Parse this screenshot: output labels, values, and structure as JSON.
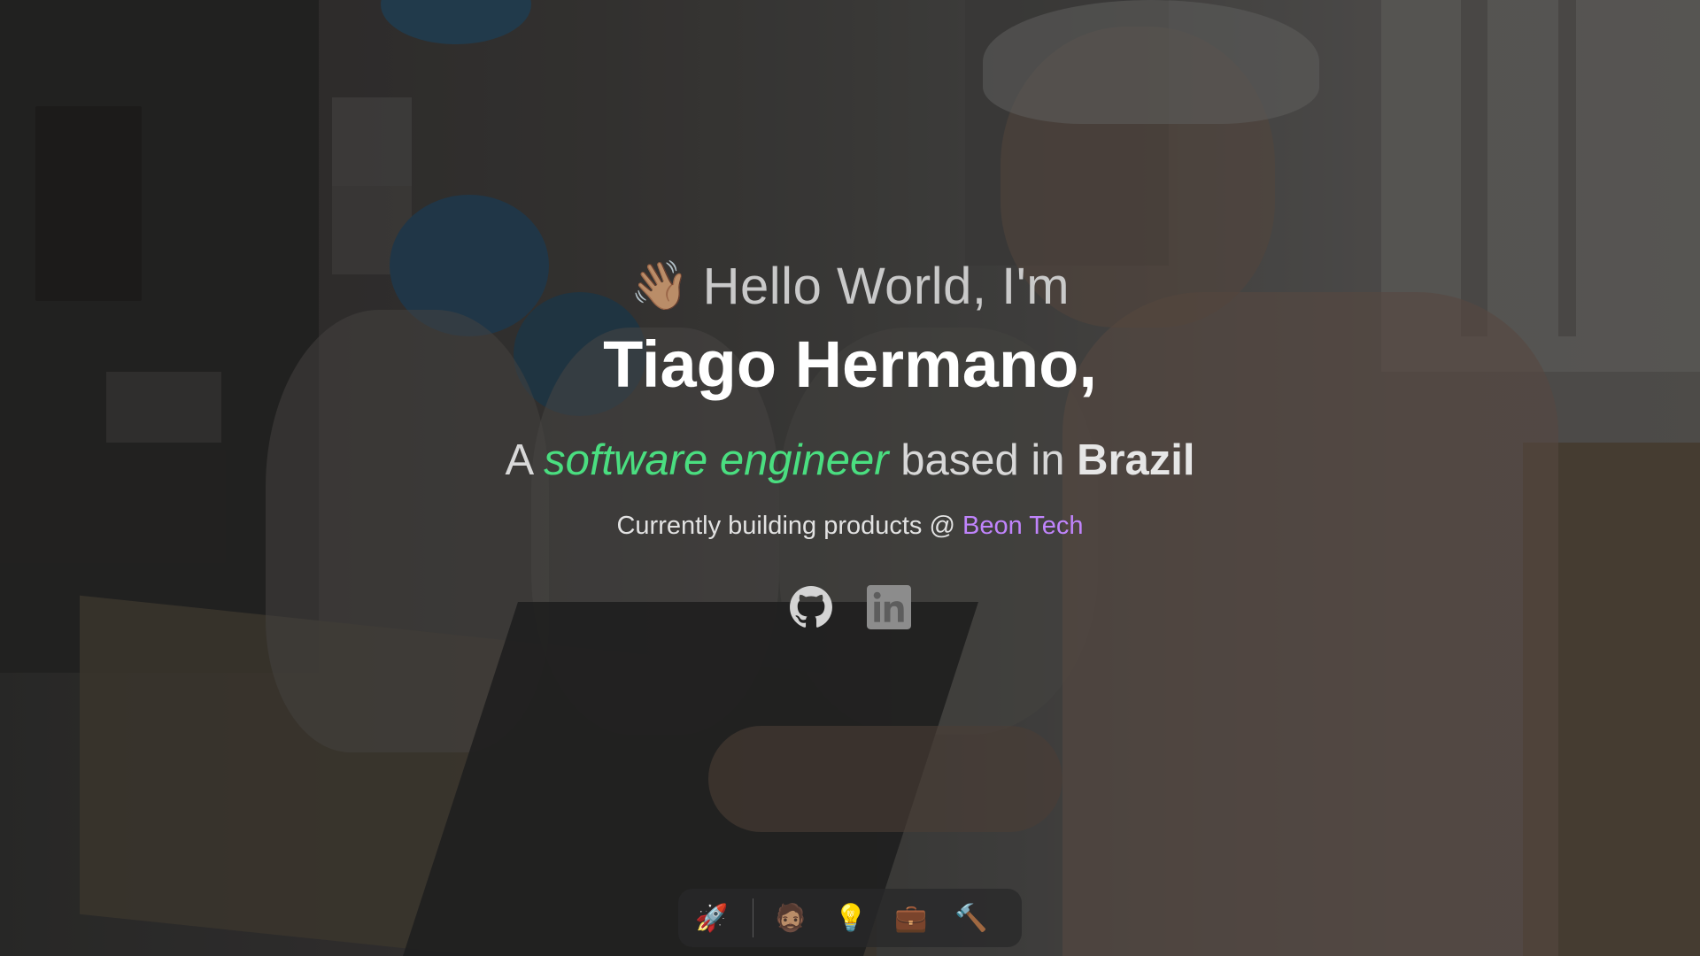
{
  "hero": {
    "greeting_icon": "👋🏽",
    "greeting": "Hello World, I'm",
    "name": "Tiago Hermano,",
    "tagline_prefix": "A",
    "tagline_role": "software engineer",
    "tagline_middle": "based in",
    "tagline_place": "Brazil",
    "currently_prefix": "Currently building products @",
    "company": "Beon Tech"
  },
  "socials": [
    {
      "icon": "github-icon"
    },
    {
      "icon": "linkedin-icon"
    }
  ],
  "dock": {
    "items": [
      {
        "icon": "rocket-icon",
        "glyph": "🚀"
      },
      {
        "icon": "person-icon",
        "glyph": "🧔🏽"
      },
      {
        "icon": "lightbulb-icon",
        "glyph": "💡"
      },
      {
        "icon": "briefcase-icon",
        "glyph": "💼"
      },
      {
        "icon": "hammer-icon",
        "glyph": "🔨"
      }
    ]
  },
  "colors": {
    "role_accent": "#4ade80",
    "company_accent": "#c084fc"
  }
}
